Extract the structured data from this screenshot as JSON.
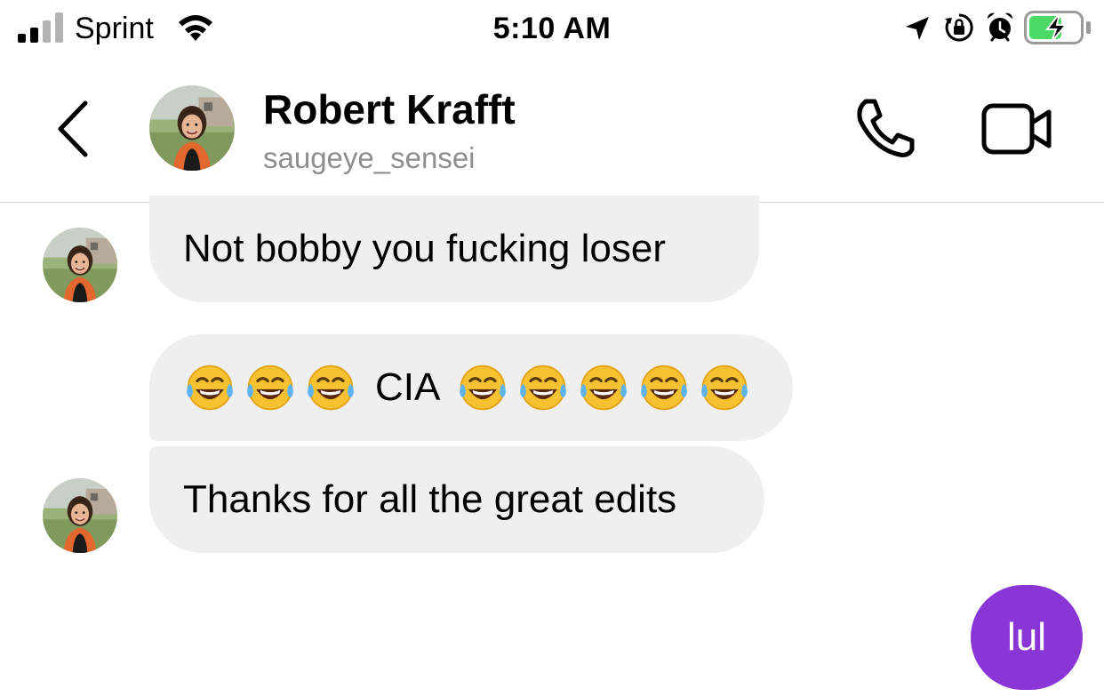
{
  "status_bar": {
    "carrier": "Sprint",
    "time": "5:10 AM",
    "signal_bars": 2,
    "battery_level": 0.55,
    "battery_state": "charging",
    "icons": [
      "signal-icon",
      "wifi-icon",
      "location-arrow-icon",
      "rotation-lock-icon",
      "alarm-icon",
      "battery-charging-icon"
    ]
  },
  "header": {
    "back_icon": "chevron-left-icon",
    "contact_name": "Robert Krafft",
    "contact_username": "saugeye_sensei",
    "call_icon": "phone-icon",
    "video_icon": "video-camera-icon"
  },
  "messages": [
    {
      "direction": "incoming",
      "text": "Not bobby you fucking loser"
    },
    {
      "direction": "incoming",
      "text_before": "",
      "emoji_before": 3,
      "text": "CIA",
      "emoji_after": 5,
      "emoji_name": "face-with-tears-of-joy-icon"
    },
    {
      "direction": "incoming",
      "text": "Thanks for all the great edits"
    },
    {
      "direction": "outgoing",
      "text": "lul"
    }
  ],
  "colors": {
    "incoming_bubble": "#efefef",
    "outgoing_bubble": "#8a35d6",
    "battery_fill": "#4cd964",
    "username_gray": "#8e8e8e"
  }
}
